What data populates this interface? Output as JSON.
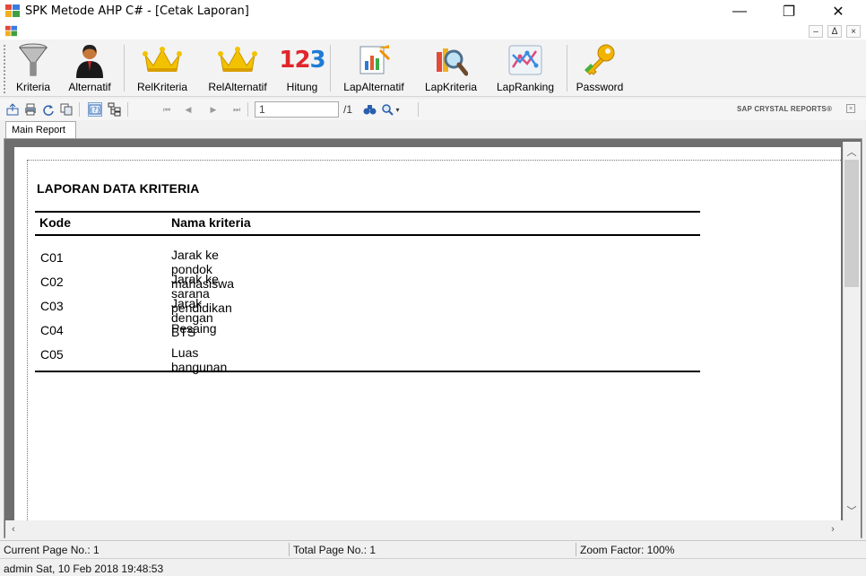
{
  "window": {
    "title": "SPK Metode AHP C# - [Cetak Laporan]",
    "minimize_glyph": "—",
    "restore_glyph": "❐",
    "close_glyph": "✕"
  },
  "mdi": {
    "minimize_glyph": "–",
    "restore_glyph": "ᐃ",
    "close_glyph": "×"
  },
  "toolbar": {
    "items": [
      {
        "label": "Kriteria",
        "icon": "funnel-icon"
      },
      {
        "label": "Alternatif",
        "icon": "user-icon"
      },
      {
        "label": "RelKriteria",
        "icon": "crown-icon"
      },
      {
        "label": "RelAlternatif",
        "icon": "crown-icon"
      },
      {
        "label": "Hitung",
        "icon": "numbers-123-icon"
      },
      {
        "label": "LapAlternatif",
        "icon": "report-chart-icon"
      },
      {
        "label": "LapKriteria",
        "icon": "magnifier-report-icon"
      },
      {
        "label": "LapRanking",
        "icon": "line-graph-icon"
      },
      {
        "label": "Password",
        "icon": "keys-icon"
      }
    ],
    "numbers_text": "123"
  },
  "viewer": {
    "page_input": "1",
    "page_total": "/1",
    "brand": "SAP CRYSTAL REPORTS®",
    "tab": "Main Report"
  },
  "report": {
    "title": "LAPORAN DATA KRITERIA",
    "columns": [
      "Kode",
      "Nama kriteria"
    ],
    "rows": [
      [
        "C01",
        "Jarak ke pondok mahasiswa"
      ],
      [
        "C02",
        "Jarak ke sarana pendidikan"
      ],
      [
        "C03",
        "Jarak dengan BTS"
      ],
      [
        "C04",
        "Pesaing"
      ],
      [
        "C05",
        "Luas bangunan"
      ]
    ]
  },
  "status": {
    "current_page": "Current Page No.: 1",
    "total_page": "Total Page No.: 1",
    "zoom": "Zoom Factor: 100%",
    "user": "admin Sat, 10 Feb 2018 19:48:53"
  },
  "colors": {
    "accent_blue": "#2b5fae",
    "crown_gold": "#f2c200",
    "hitung_red": "#e0262b",
    "hitung_blue": "#1e7bd6"
  }
}
